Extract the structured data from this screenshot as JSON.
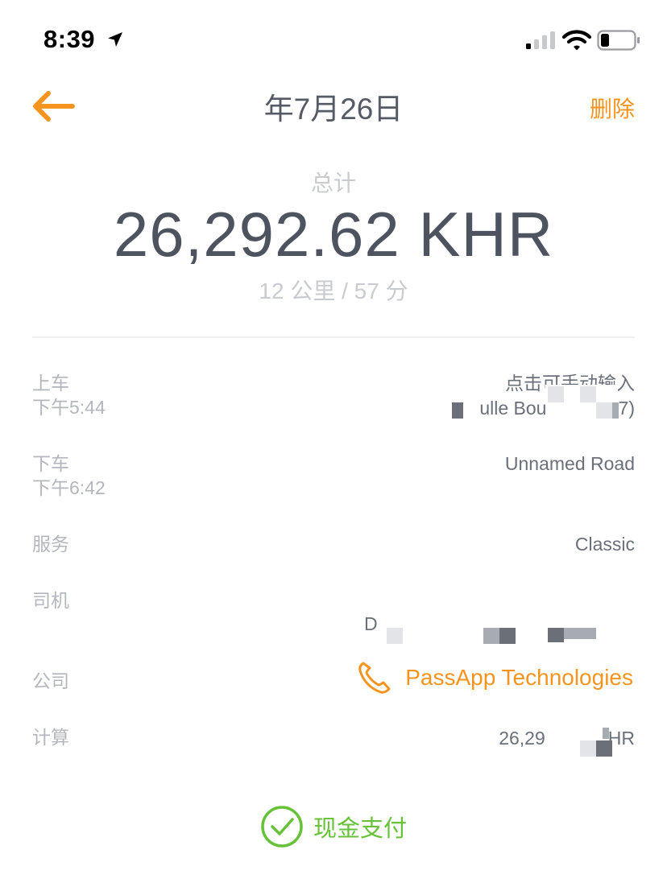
{
  "status_bar": {
    "time": "8:39"
  },
  "nav": {
    "title": "年7月26日",
    "delete_label": "删除"
  },
  "summary": {
    "total_label": "总计",
    "total_amount": "26,292.62 KHR",
    "trip_stats": "12 公里 / 57 分"
  },
  "details": {
    "pickup": {
      "label": "上车",
      "time": "下午5:44",
      "hint": "点击可手动输入",
      "address": "ulle Boul",
      "address_tail": "7)"
    },
    "dropoff": {
      "label": "下车",
      "time": "下午6:42",
      "address": "Unnamed Road"
    },
    "service": {
      "label": "服务",
      "value": "Classic"
    },
    "driver": {
      "label": "司机",
      "name_initial": "D"
    },
    "company": {
      "label": "公司",
      "name": "PassApp Technologies"
    },
    "calculation": {
      "label": "计算",
      "value_start": "26,29",
      "value_end": "HR"
    }
  },
  "payment": {
    "method": "现金支付"
  },
  "colors": {
    "accent": "#f5941e",
    "success": "#67c23a",
    "text_primary": "#4d5460",
    "text_muted": "#b3b7bd"
  }
}
